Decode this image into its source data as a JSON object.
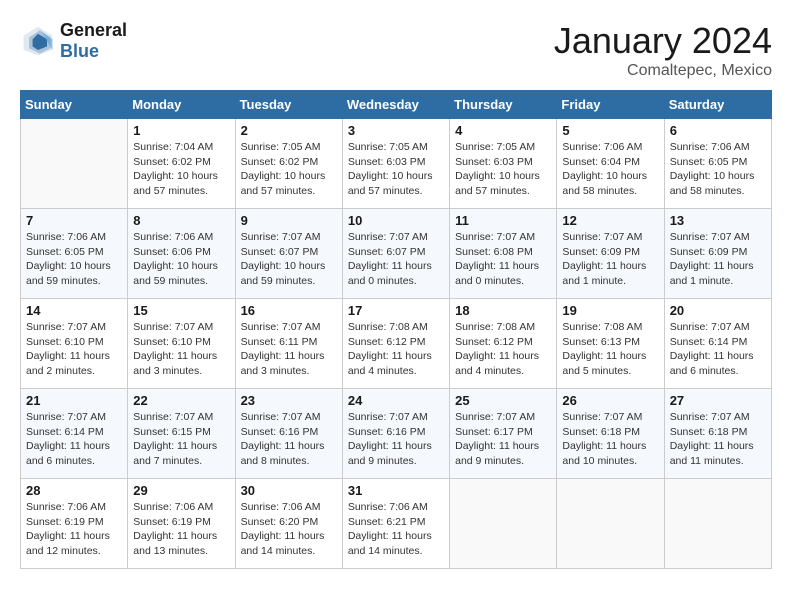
{
  "header": {
    "logo_line1": "General",
    "logo_line2": "Blue",
    "month": "January 2024",
    "location": "Comaltepec, Mexico"
  },
  "days_of_week": [
    "Sunday",
    "Monday",
    "Tuesday",
    "Wednesday",
    "Thursday",
    "Friday",
    "Saturday"
  ],
  "weeks": [
    [
      {
        "day": "",
        "info": ""
      },
      {
        "day": "1",
        "info": "Sunrise: 7:04 AM\nSunset: 6:02 PM\nDaylight: 10 hours\nand 57 minutes."
      },
      {
        "day": "2",
        "info": "Sunrise: 7:05 AM\nSunset: 6:02 PM\nDaylight: 10 hours\nand 57 minutes."
      },
      {
        "day": "3",
        "info": "Sunrise: 7:05 AM\nSunset: 6:03 PM\nDaylight: 10 hours\nand 57 minutes."
      },
      {
        "day": "4",
        "info": "Sunrise: 7:05 AM\nSunset: 6:03 PM\nDaylight: 10 hours\nand 57 minutes."
      },
      {
        "day": "5",
        "info": "Sunrise: 7:06 AM\nSunset: 6:04 PM\nDaylight: 10 hours\nand 58 minutes."
      },
      {
        "day": "6",
        "info": "Sunrise: 7:06 AM\nSunset: 6:05 PM\nDaylight: 10 hours\nand 58 minutes."
      }
    ],
    [
      {
        "day": "7",
        "info": "Sunrise: 7:06 AM\nSunset: 6:05 PM\nDaylight: 10 hours\nand 59 minutes."
      },
      {
        "day": "8",
        "info": "Sunrise: 7:06 AM\nSunset: 6:06 PM\nDaylight: 10 hours\nand 59 minutes."
      },
      {
        "day": "9",
        "info": "Sunrise: 7:07 AM\nSunset: 6:07 PM\nDaylight: 10 hours\nand 59 minutes."
      },
      {
        "day": "10",
        "info": "Sunrise: 7:07 AM\nSunset: 6:07 PM\nDaylight: 11 hours\nand 0 minutes."
      },
      {
        "day": "11",
        "info": "Sunrise: 7:07 AM\nSunset: 6:08 PM\nDaylight: 11 hours\nand 0 minutes."
      },
      {
        "day": "12",
        "info": "Sunrise: 7:07 AM\nSunset: 6:09 PM\nDaylight: 11 hours\nand 1 minute."
      },
      {
        "day": "13",
        "info": "Sunrise: 7:07 AM\nSunset: 6:09 PM\nDaylight: 11 hours\nand 1 minute."
      }
    ],
    [
      {
        "day": "14",
        "info": "Sunrise: 7:07 AM\nSunset: 6:10 PM\nDaylight: 11 hours\nand 2 minutes."
      },
      {
        "day": "15",
        "info": "Sunrise: 7:07 AM\nSunset: 6:10 PM\nDaylight: 11 hours\nand 3 minutes."
      },
      {
        "day": "16",
        "info": "Sunrise: 7:07 AM\nSunset: 6:11 PM\nDaylight: 11 hours\nand 3 minutes."
      },
      {
        "day": "17",
        "info": "Sunrise: 7:08 AM\nSunset: 6:12 PM\nDaylight: 11 hours\nand 4 minutes."
      },
      {
        "day": "18",
        "info": "Sunrise: 7:08 AM\nSunset: 6:12 PM\nDaylight: 11 hours\nand 4 minutes."
      },
      {
        "day": "19",
        "info": "Sunrise: 7:08 AM\nSunset: 6:13 PM\nDaylight: 11 hours\nand 5 minutes."
      },
      {
        "day": "20",
        "info": "Sunrise: 7:07 AM\nSunset: 6:14 PM\nDaylight: 11 hours\nand 6 minutes."
      }
    ],
    [
      {
        "day": "21",
        "info": "Sunrise: 7:07 AM\nSunset: 6:14 PM\nDaylight: 11 hours\nand 6 minutes."
      },
      {
        "day": "22",
        "info": "Sunrise: 7:07 AM\nSunset: 6:15 PM\nDaylight: 11 hours\nand 7 minutes."
      },
      {
        "day": "23",
        "info": "Sunrise: 7:07 AM\nSunset: 6:16 PM\nDaylight: 11 hours\nand 8 minutes."
      },
      {
        "day": "24",
        "info": "Sunrise: 7:07 AM\nSunset: 6:16 PM\nDaylight: 11 hours\nand 9 minutes."
      },
      {
        "day": "25",
        "info": "Sunrise: 7:07 AM\nSunset: 6:17 PM\nDaylight: 11 hours\nand 9 minutes."
      },
      {
        "day": "26",
        "info": "Sunrise: 7:07 AM\nSunset: 6:18 PM\nDaylight: 11 hours\nand 10 minutes."
      },
      {
        "day": "27",
        "info": "Sunrise: 7:07 AM\nSunset: 6:18 PM\nDaylight: 11 hours\nand 11 minutes."
      }
    ],
    [
      {
        "day": "28",
        "info": "Sunrise: 7:06 AM\nSunset: 6:19 PM\nDaylight: 11 hours\nand 12 minutes."
      },
      {
        "day": "29",
        "info": "Sunrise: 7:06 AM\nSunset: 6:19 PM\nDaylight: 11 hours\nand 13 minutes."
      },
      {
        "day": "30",
        "info": "Sunrise: 7:06 AM\nSunset: 6:20 PM\nDaylight: 11 hours\nand 14 minutes."
      },
      {
        "day": "31",
        "info": "Sunrise: 7:06 AM\nSunset: 6:21 PM\nDaylight: 11 hours\nand 14 minutes."
      },
      {
        "day": "",
        "info": ""
      },
      {
        "day": "",
        "info": ""
      },
      {
        "day": "",
        "info": ""
      }
    ]
  ]
}
